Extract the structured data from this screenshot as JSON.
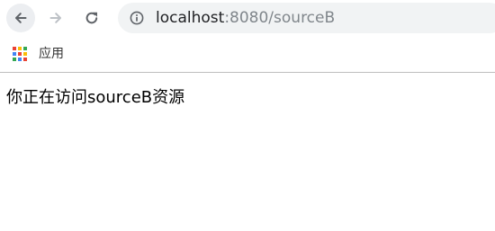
{
  "toolbar": {
    "back_icon": "back-arrow-icon",
    "forward_icon": "forward-arrow-icon",
    "reload_icon": "reload-icon",
    "address": {
      "info_icon": "info-icon",
      "host": "localhost",
      "path": ":8080/sourceB"
    }
  },
  "bookmarks": {
    "items": [
      {
        "icon": "apps-grid-icon",
        "label": "应用"
      }
    ]
  },
  "page": {
    "text": "你正在访问sourceB资源"
  },
  "colors": {
    "apps_grid": [
      "#ea4335",
      "#fbbc05",
      "#34a853",
      "#4285f4",
      "#ea4335",
      "#fbbc05",
      "#34a853",
      "#4285f4",
      "#ea4335"
    ],
    "divider": "#bdbdbd"
  }
}
